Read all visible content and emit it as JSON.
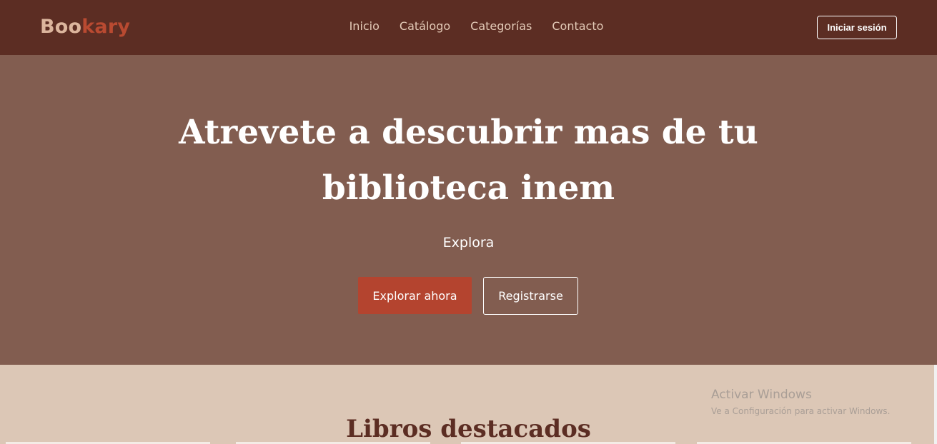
{
  "navbar": {
    "logo_part1": "Boo",
    "logo_part2": "kary",
    "links": [
      "Inicio",
      "Catálogo",
      "Categorías",
      "Contacto"
    ],
    "login_label": "Iniciar sesión"
  },
  "hero": {
    "title_line1": "Atrevete a descubrir mas de tu",
    "title_line2": "biblioteca inem",
    "subtitle": "Explora",
    "primary_button": "Explorar ahora",
    "secondary_button": "Registrarse"
  },
  "featured": {
    "title": "Libros destacados"
  },
  "watermark": {
    "title": "Activar Windows",
    "subtitle": "Ve a Configuración para activar Windows."
  },
  "colors": {
    "navbar_bg": "#5c2d23",
    "hero_bg": "#825d50",
    "accent": "#b4442f",
    "section_bg": "#dcc7b6"
  }
}
